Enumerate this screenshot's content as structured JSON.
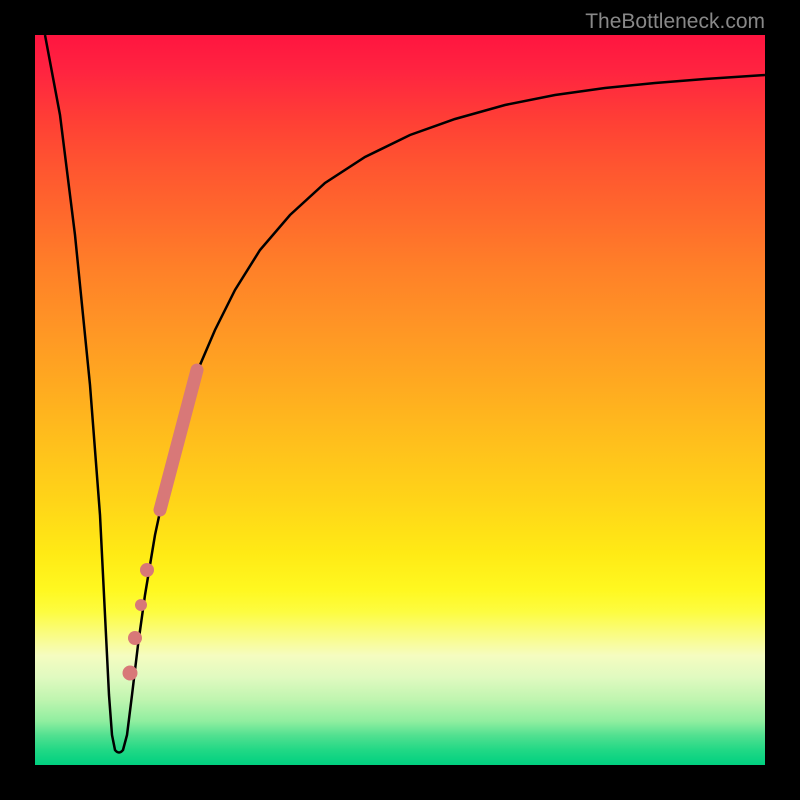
{
  "watermark": "TheBottleneck.com",
  "chart_data": {
    "type": "line",
    "title": "",
    "xlabel": "",
    "ylabel": "",
    "xlim": [
      0,
      100
    ],
    "ylim": [
      0,
      100
    ],
    "series": [
      {
        "name": "bottleneck-curve",
        "description": "V-shaped curve with asymptotic right tail",
        "x": [
          0,
          2,
          4,
          6,
          8,
          9,
          10,
          11,
          12,
          14,
          16,
          18,
          20,
          22,
          24,
          26,
          28,
          32,
          36,
          40,
          45,
          50,
          55,
          60,
          65,
          70,
          80,
          90,
          100
        ],
        "values": [
          100,
          80,
          60,
          40,
          20,
          8,
          2,
          2,
          8,
          20,
          32,
          42,
          50,
          56,
          61,
          65,
          69,
          75,
          79,
          82,
          85,
          87,
          89,
          90.5,
          91.5,
          92,
          93,
          93.5,
          94
        ]
      }
    ],
    "highlight_segment": {
      "description": "Pink highlighted segment on right branch",
      "bar": {
        "x1": 17,
        "y1": 36,
        "x2": 22,
        "y2": 55
      },
      "dots": [
        {
          "x": 15.2,
          "y": 27,
          "r": 6
        },
        {
          "x": 14.2,
          "y": 22,
          "r": 5.5
        },
        {
          "x": 13.5,
          "y": 17.5,
          "r": 5.8
        },
        {
          "x": 12.8,
          "y": 13,
          "r": 6
        }
      ]
    },
    "gradient_colors": {
      "top": "#ff1540",
      "middle": "#ffea15",
      "bottom": "#00d080"
    }
  }
}
